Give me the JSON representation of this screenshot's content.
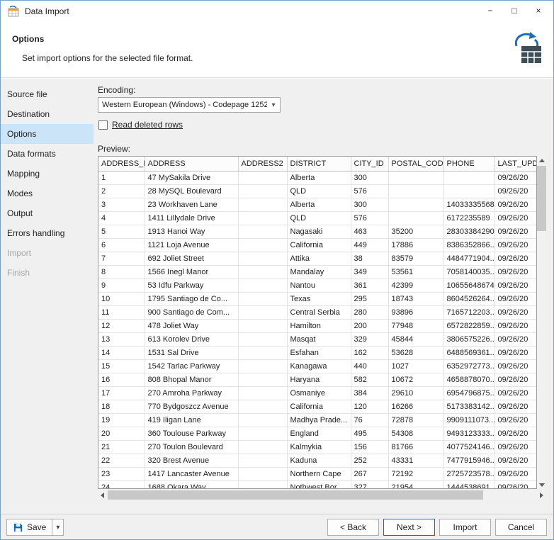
{
  "window": {
    "title": "Data Import"
  },
  "icons": {
    "minimize": "−",
    "maximize": "□",
    "close": "×",
    "dropdown": "▾"
  },
  "header": {
    "title": "Options",
    "subtitle": "Set import options for the selected file format."
  },
  "sidebar": {
    "items": [
      {
        "label": "Source file",
        "state": "normal"
      },
      {
        "label": "Destination",
        "state": "normal"
      },
      {
        "label": "Options",
        "state": "selected"
      },
      {
        "label": "Data formats",
        "state": "normal"
      },
      {
        "label": "Mapping",
        "state": "normal"
      },
      {
        "label": "Modes",
        "state": "normal"
      },
      {
        "label": "Output",
        "state": "normal"
      },
      {
        "label": "Errors handling",
        "state": "normal"
      },
      {
        "label": "Import",
        "state": "disabled"
      },
      {
        "label": "Finish",
        "state": "disabled"
      }
    ]
  },
  "options_panel": {
    "encoding_label": "Encoding:",
    "encoding_value": "Western European (Windows) - Codepage 1252",
    "read_deleted_label": "Read deleted rows",
    "read_deleted_checked": false,
    "preview_label": "Preview:"
  },
  "table": {
    "columns": [
      "ADDRESS_ID",
      "ADDRESS",
      "ADDRESS2",
      "DISTRICT",
      "CITY_ID",
      "POSTAL_COD",
      "PHONE",
      "LAST_UPDAT"
    ],
    "rows": [
      [
        "1",
        "47 MySakila Drive",
        "",
        "Alberta",
        "300",
        "",
        "",
        "09/26/20"
      ],
      [
        "2",
        "28 MySQL Boulevard",
        "",
        "QLD",
        "576",
        "",
        "",
        "09/26/20"
      ],
      [
        "3",
        "23 Workhaven Lane",
        "",
        "Alberta",
        "300",
        "",
        "14033335568",
        "09/26/20"
      ],
      [
        "4",
        "1411 Lillydale Drive",
        "",
        "QLD",
        "576",
        "",
        "6172235589",
        "09/26/20"
      ],
      [
        "5",
        "1913 Hanoi Way",
        "",
        "Nagasaki",
        "463",
        "35200",
        "28303384290",
        "09/26/20"
      ],
      [
        "6",
        "1121 Loja Avenue",
        "",
        "California",
        "449",
        "17886",
        "8386352866...",
        "09/26/20"
      ],
      [
        "7",
        "692 Joliet Street",
        "",
        "Attika",
        "38",
        "83579",
        "4484771904...",
        "09/26/20"
      ],
      [
        "8",
        "1566 Inegl Manor",
        "",
        "Mandalay",
        "349",
        "53561",
        "7058140035...",
        "09/26/20"
      ],
      [
        "9",
        "53 Idfu Parkway",
        "",
        "Nantou",
        "361",
        "42399",
        "10655648674",
        "09/26/20"
      ],
      [
        "10",
        "1795 Santiago de Co...",
        "",
        "Texas",
        "295",
        "18743",
        "8604526264...",
        "09/26/20"
      ],
      [
        "11",
        "900 Santiago de Com...",
        "",
        "Central Serbia",
        "280",
        "93896",
        "7165712203...",
        "09/26/20"
      ],
      [
        "12",
        "478 Joliet Way",
        "",
        "Hamilton",
        "200",
        "77948",
        "6572822859...",
        "09/26/20"
      ],
      [
        "13",
        "613 Korolev Drive",
        "",
        "Masqat",
        "329",
        "45844",
        "3806575226...",
        "09/26/20"
      ],
      [
        "14",
        "1531 Sal Drive",
        "",
        "Esfahan",
        "162",
        "53628",
        "6488569361...",
        "09/26/20"
      ],
      [
        "15",
        "1542 Tarlac Parkway",
        "",
        "Kanagawa",
        "440",
        "1027",
        "6352972773...",
        "09/26/20"
      ],
      [
        "16",
        "808 Bhopal Manor",
        "",
        "Haryana",
        "582",
        "10672",
        "4658878070...",
        "09/26/20"
      ],
      [
        "17",
        "270 Amroha Parkway",
        "",
        "Osmaniye",
        "384",
        "29610",
        "6954796875...",
        "09/26/20"
      ],
      [
        "18",
        "770 Bydgoszcz Avenue",
        "",
        "California",
        "120",
        "16266",
        "5173383142...",
        "09/26/20"
      ],
      [
        "19",
        "419 Iligan Lane",
        "",
        "Madhya Prade...",
        "76",
        "72878",
        "9909111073...",
        "09/26/20"
      ],
      [
        "20",
        "360 Toulouse Parkway",
        "",
        "England",
        "495",
        "54308",
        "9493123333...",
        "09/26/20"
      ],
      [
        "21",
        "270 Toulon Boulevard",
        "",
        "Kalmykia",
        "156",
        "81766",
        "4077524146...",
        "09/26/20"
      ],
      [
        "22",
        "320 Brest Avenue",
        "",
        "Kaduna",
        "252",
        "43331",
        "7477915946...",
        "09/26/20"
      ],
      [
        "23",
        "1417 Lancaster Avenue",
        "",
        "Northern Cape",
        "267",
        "72192",
        "2725723578...",
        "09/26/20"
      ],
      [
        "24",
        "1688 Okara Way",
        "",
        "Nothwest Bor...",
        "327",
        "21954",
        "1444538691",
        "09/26/20"
      ]
    ]
  },
  "footer": {
    "save_label": "Save",
    "back_label": "< Back",
    "next_label": "Next >",
    "import_label": "Import",
    "cancel_label": "Cancel"
  },
  "colors": {
    "sidebar_selection": "#cbe4f7",
    "accent_blue": "#1e6bb8",
    "default_button_border": "#0a6cbd"
  }
}
